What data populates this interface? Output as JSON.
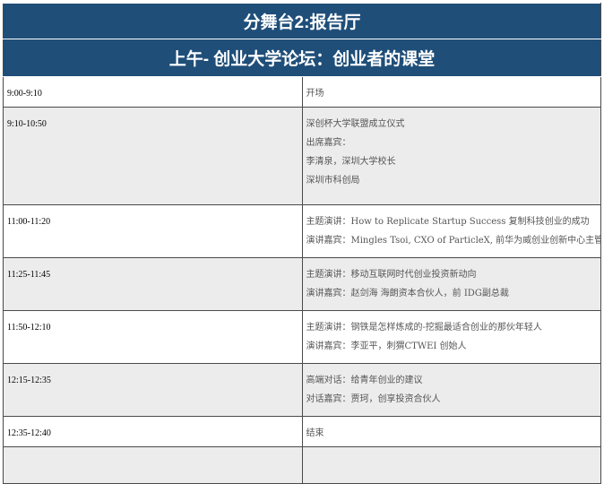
{
  "header": {
    "title": "分舞台2:报告厅",
    "subtitle": "上午- 创业大学论坛：创业者的课堂"
  },
  "rows": [
    {
      "time": "9:00-9:10",
      "lines": [
        "开场"
      ]
    },
    {
      "time": "9:10-10:50",
      "lines": [
        "深创杯大学联盟成立仪式",
        "出席嘉宾：",
        "李清泉，深圳大学校长",
        "深圳市科创局"
      ]
    },
    {
      "time": "11:00-11:20",
      "lines": [
        "主题演讲：How to Replicate Startup Success 复制科技创业的成功",
        "演讲嘉宾：Mingles Tsoi, CXO of ParticleX, 前华为威创业创新中心主管"
      ]
    },
    {
      "time": "11:25-11:45",
      "lines": [
        "主题演讲：移动互联网时代创业投资新动向",
        "演讲嘉宾：赵剑海 海朗资本合伙人，前 IDG副总裁"
      ]
    },
    {
      "time": "11:50-12:10",
      "lines": [
        "主题演讲：钢铁是怎样炼成的-挖掘最适合创业的那伙年轻人",
        "演讲嘉宾：李亚平，刺猬CTWEI 创始人"
      ]
    },
    {
      "time": "12:15-12:35",
      "lines": [
        "高端对话：给青年创业的建议",
        "对话嘉宾：贾珂，创享投资合伙人"
      ]
    },
    {
      "time": "12:35-12:40",
      "lines": [
        "结束"
      ]
    },
    {
      "time": "",
      "lines": []
    }
  ]
}
